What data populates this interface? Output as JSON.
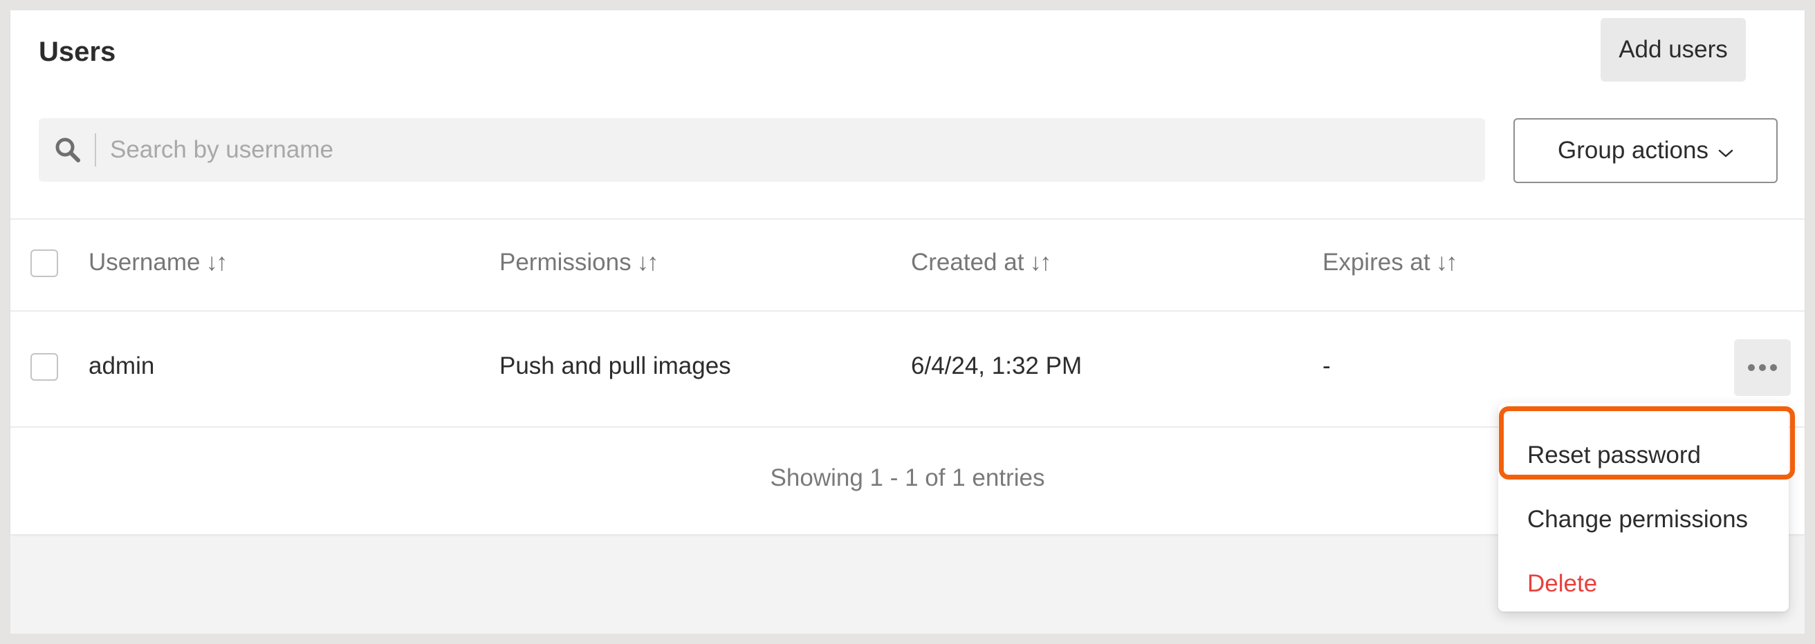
{
  "header": {
    "title": "Users",
    "add_button_label": "Add users"
  },
  "search": {
    "placeholder": "Search by username",
    "icon": "search-icon"
  },
  "group_actions": {
    "label": "Group actions",
    "icon": "chevron-down-icon"
  },
  "table": {
    "sort_indicator": "↓↑",
    "columns": [
      "Username",
      "Permissions",
      "Created at",
      "Expires at"
    ],
    "rows": [
      {
        "username": "admin",
        "permissions": "Push and pull images",
        "created_at": "6/4/24, 1:32 PM",
        "expires_at": "-"
      }
    ],
    "row_actions_icon": "more-horizontal-icon"
  },
  "footer": {
    "summary": "Showing 1 - 1 of 1 entries"
  },
  "row_menu": {
    "items": [
      "Reset password",
      "Change permissions",
      "Delete"
    ]
  },
  "colors": {
    "highlight": "#f2600c",
    "danger": "#e8403c"
  }
}
